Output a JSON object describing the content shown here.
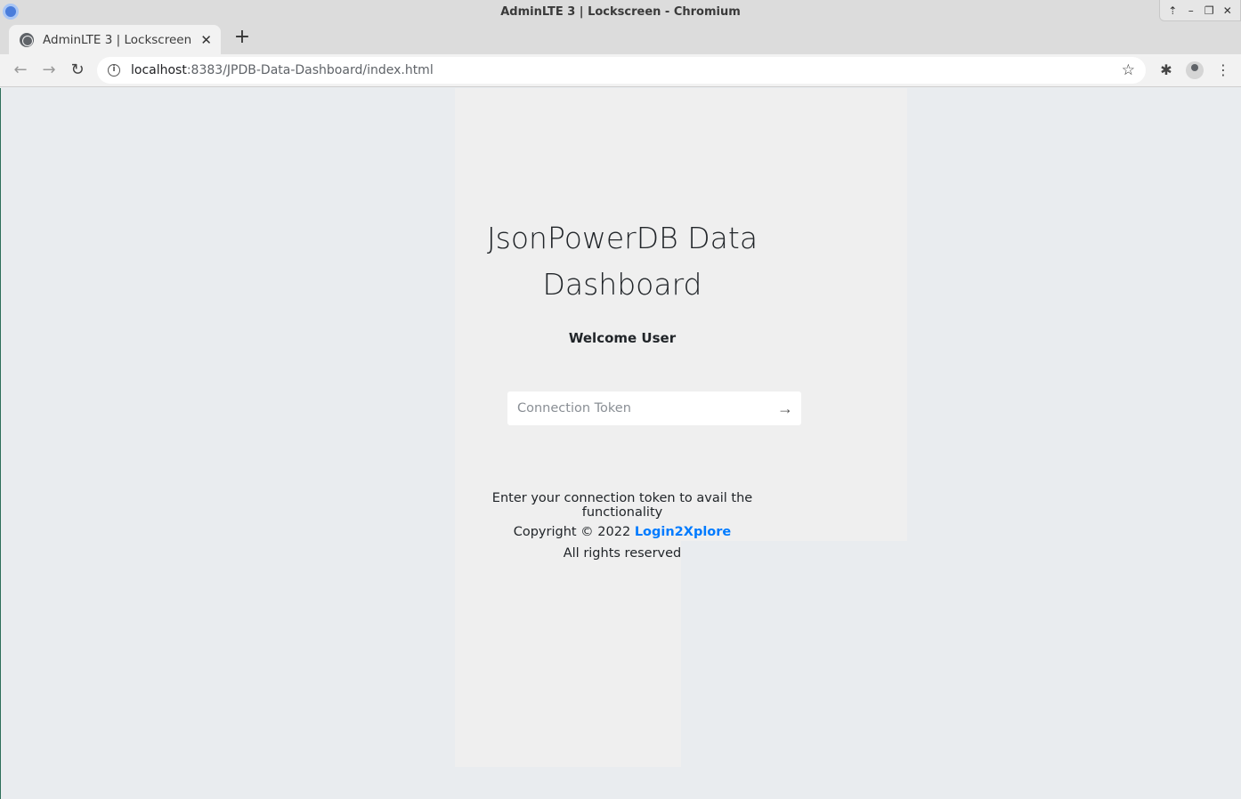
{
  "window": {
    "title": "AdminLTE 3 | Lockscreen - Chromium",
    "controls": [
      "⇡",
      "–",
      "❐",
      "✕"
    ]
  },
  "tab": {
    "label": "AdminLTE 3 | Lockscreen",
    "close": "✕"
  },
  "new_tab": "+",
  "address_bar": {
    "host": "localhost",
    "path": ":8383/JPDB-Data-Dashboard/index.html"
  },
  "toolbar_icons": {
    "back": "←",
    "forward": "→",
    "reload": "↻",
    "bookmark": "☆",
    "extensions": "✱",
    "menu": "⋮"
  },
  "page": {
    "brand_line1": "JsonPowerDB Data",
    "brand_line2": "Dashboard",
    "welcome": "Welcome User",
    "token_placeholder": "Connection Token",
    "submit_icon": "→",
    "help_text": "Enter your connection token to avail the functionality",
    "copyright_prefix": "Copyright © 2022 ",
    "copyright_link": "Login2Xplore",
    "rights": "All rights reserved"
  },
  "colors": {
    "page_background": "#e9ecef",
    "panel_background": "#efefef",
    "link": "#007bff"
  }
}
